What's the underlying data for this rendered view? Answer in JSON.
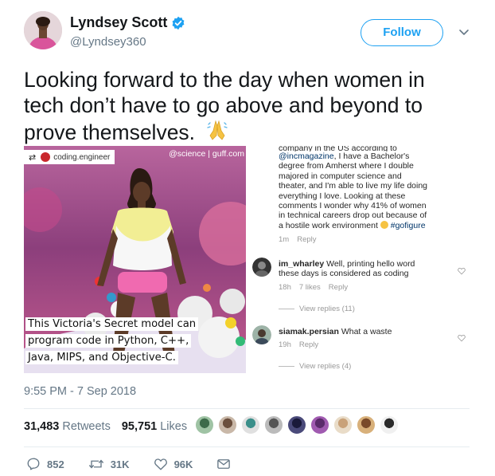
{
  "user": {
    "display_name": "Lyndsey Scott",
    "handle": "@Lyndsey360",
    "verified": true,
    "follow_label": "Follow"
  },
  "tweet": {
    "text": "Looking forward to the day when women in tech don’t have to go above and beyond to prove themselves.",
    "emoji": "🙏",
    "timestamp": "9:55 PM - 7 Sep 2018"
  },
  "media": {
    "repost_tag": "coding.engineer",
    "watermark": "@science | guff.com",
    "caption_lines": [
      "This Victoria's Secret model can",
      "program code in Python, C++,",
      "Java, MIPS, and Objective-C."
    ],
    "comments": {
      "top": {
        "line1": "company in the US according to",
        "mention": "@incmagazine",
        "line2": ", I have a Bachelor's",
        "line3": "degree from Amherst where I double",
        "line4": "majored in computer science and",
        "line5": "theater, and I'm able to live my life doing",
        "line6": "everything I love. Looking at these",
        "line7": "comments I wonder why 41% of women",
        "line8": "in technical careers drop out because of",
        "line9": "a hostile work environment",
        "hashtag": "#gofigure",
        "time": "1m",
        "reply": "Reply"
      },
      "items": [
        {
          "user": "im_wharley",
          "text1": "Well, printing hello word",
          "text2": "these days is considered as coding",
          "time": "18h",
          "likes": "7 likes",
          "reply": "Reply",
          "view_replies": "View replies (11)"
        },
        {
          "user": "siamak.persian",
          "text1": "What a waste",
          "time": "19h",
          "reply": "Reply",
          "view_replies": "View replies (4)"
        }
      ]
    }
  },
  "stats": {
    "retweets_count": "31,483",
    "retweets_label": "Retweets",
    "likes_count": "95,751",
    "likes_label": "Likes"
  },
  "actions": {
    "replies": "852",
    "retweets": "31K",
    "likes": "96K"
  },
  "colors": {
    "brand_blue": "#1da1f2",
    "secondary_text": "#657786",
    "ig_link": "#003569"
  }
}
